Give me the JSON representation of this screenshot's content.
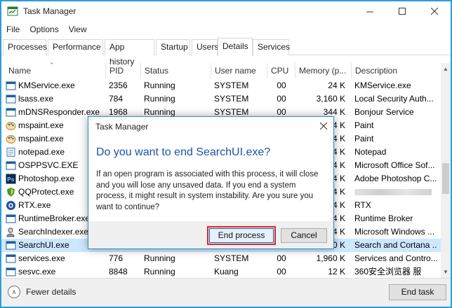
{
  "window": {
    "title": "Task Manager",
    "accent": "#2a9fd8"
  },
  "menu": [
    "File",
    "Options",
    "View"
  ],
  "tabs": [
    {
      "label": "Processes"
    },
    {
      "label": "Performance"
    },
    {
      "label": "App history"
    },
    {
      "label": "Startup"
    },
    {
      "label": "Users"
    },
    {
      "label": "Details",
      "active": true
    },
    {
      "label": "Services"
    }
  ],
  "columns": {
    "name": "Name",
    "pid": "PID",
    "status": "Status",
    "user": "User name",
    "cpu": "CPU",
    "memory": "Memory (p...",
    "description": "Description"
  },
  "rows": [
    {
      "name": "KMService.exe",
      "pid": "2356",
      "status": "Running",
      "user": "SYSTEM",
      "cpu": "00",
      "mem": "24 K",
      "desc": "KMService.exe",
      "icon": "app-window-icon"
    },
    {
      "name": "lsass.exe",
      "pid": "784",
      "status": "Running",
      "user": "SYSTEM",
      "cpu": "00",
      "mem": "3,160 K",
      "desc": "Local Security Auth...",
      "icon": "app-window-icon"
    },
    {
      "name": "mDNSResponder.exe",
      "pid": "1968",
      "status": "Running",
      "user": "SYSTEM",
      "cpu": "00",
      "mem": "344 K",
      "desc": "Bonjour Service",
      "icon": "app-window-icon"
    },
    {
      "name": "mspaint.exe",
      "pid": "",
      "status": "",
      "user": "",
      "cpu": "",
      "mem": "4 K",
      "desc": "Paint",
      "icon": "paint-icon"
    },
    {
      "name": "mspaint.exe",
      "pid": "",
      "status": "",
      "user": "",
      "cpu": "",
      "mem": "4 K",
      "desc": "Paint",
      "icon": "paint-icon"
    },
    {
      "name": "notepad.exe",
      "pid": "",
      "status": "",
      "user": "",
      "cpu": "",
      "mem": "4 K",
      "desc": "Notepad",
      "icon": "notepad-icon"
    },
    {
      "name": "OSPPSVC.EXE",
      "pid": "",
      "status": "",
      "user": "",
      "cpu": "",
      "mem": "4 K",
      "desc": "Microsoft Office Sof...",
      "icon": "app-window-icon"
    },
    {
      "name": "Photoshop.exe",
      "pid": "",
      "status": "",
      "user": "",
      "cpu": "",
      "mem": "4 K",
      "desc": "Adobe Photoshop C...",
      "icon": "photoshop-icon"
    },
    {
      "name": "QQProtect.exe",
      "pid": "",
      "status": "",
      "user": "",
      "cpu": "",
      "mem": "4 K",
      "desc": "",
      "icon": "qq-protect-icon"
    },
    {
      "name": "RTX.exe",
      "pid": "",
      "status": "",
      "user": "",
      "cpu": "",
      "mem": "4 K",
      "desc": "RTX",
      "icon": "rtx-icon"
    },
    {
      "name": "RuntimeBroker.exe",
      "pid": "",
      "status": "",
      "user": "",
      "cpu": "",
      "mem": "4 K",
      "desc": "Runtime Broker",
      "icon": "app-window-icon"
    },
    {
      "name": "SearchIndexer.exe",
      "pid": "",
      "status": "",
      "user": "",
      "cpu": "",
      "mem": "4 K",
      "desc": "Microsoft Windows ...",
      "icon": "search-indexer-icon"
    },
    {
      "name": "SearchUI.exe",
      "pid": "",
      "status": "",
      "user": "",
      "cpu": "",
      "mem": "0 K",
      "desc": "Search and Cortana ...",
      "icon": "app-window-icon",
      "selected": true
    },
    {
      "name": "services.exe",
      "pid": "776",
      "status": "Running",
      "user": "SYSTEM",
      "cpu": "00",
      "mem": "1,960 K",
      "desc": "Services and Contro...",
      "icon": "app-window-icon"
    },
    {
      "name": "sesvc.exe",
      "pid": "8848",
      "status": "Running",
      "user": "Kuang",
      "cpu": "00",
      "mem": "12 K",
      "desc": "360安全浏览器 服",
      "icon": "app-window-icon"
    }
  ],
  "footer": {
    "fewer_details": "Fewer details",
    "end_task": "End task"
  },
  "dialog": {
    "title": "Task Manager",
    "heading": "Do you want to end SearchUI.exe?",
    "body": "If an open program is associated with this process, it will close and you will lose any unsaved data. If you end a system process, it might result in system instability. Are you sure you want to continue?",
    "confirm": "End process",
    "cancel": "Cancel",
    "highlight_color": "#e3232b"
  }
}
